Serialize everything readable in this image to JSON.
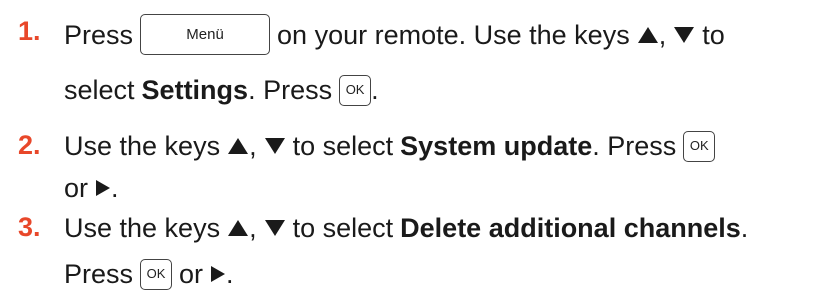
{
  "steps": [
    {
      "number": "1.",
      "press": "Press",
      "menu_key": "Menü",
      "text_a": "on your remote. Use the keys",
      "comma": ",",
      "text_to": "to",
      "select": "select",
      "settings": "Settings",
      "press2": ". Press",
      "ok_key": "OK",
      "period": "."
    },
    {
      "number": "2.",
      "use_keys": "Use the keys",
      "comma": ",",
      "text_select": "to select",
      "system_update": "System update",
      "press": ". Press",
      "ok_key": "OK",
      "or": "or",
      "period": "."
    },
    {
      "number": "3.",
      "use_keys": "Use the keys",
      "comma": ",",
      "text_select": "to select",
      "delete_channels": "Delete additional channels",
      "period": ".",
      "press": "Press",
      "ok_key": "OK",
      "or": "or",
      "period2": "."
    }
  ],
  "icons": {
    "up": "up-triangle-icon",
    "down": "down-triangle-icon",
    "right": "right-triangle-icon"
  },
  "colors": {
    "step_number": "#e8472a",
    "text": "#1a1a1a"
  }
}
